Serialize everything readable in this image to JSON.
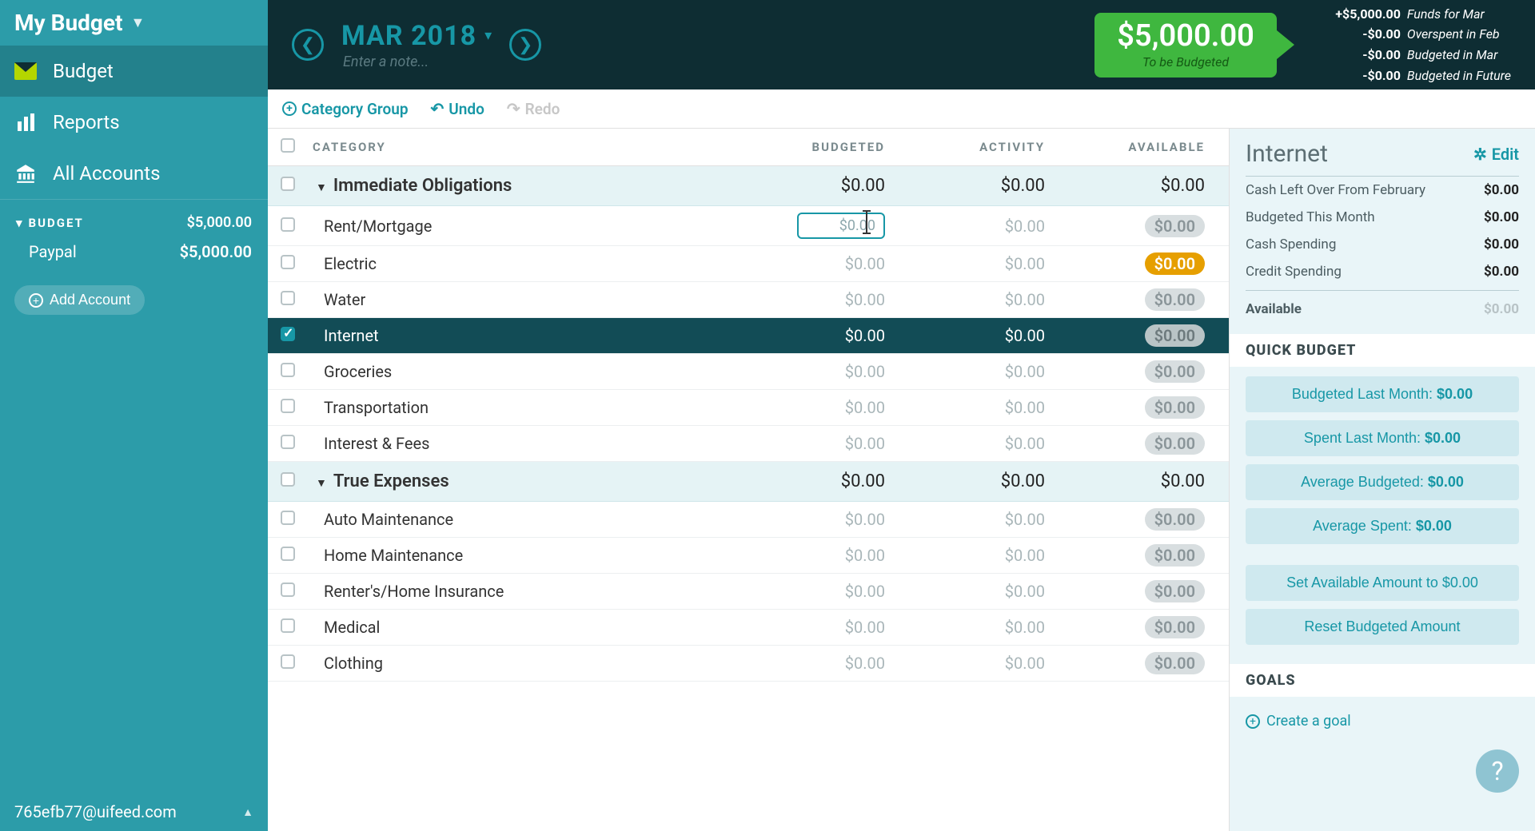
{
  "sidebar": {
    "title": "My Budget",
    "nav": [
      {
        "label": "Budget"
      },
      {
        "label": "Reports"
      },
      {
        "label": "All Accounts"
      }
    ],
    "budget_header": "BUDGET",
    "budget_total": "$5,000.00",
    "accounts": [
      {
        "name": "Paypal",
        "balance": "$5,000.00"
      }
    ],
    "add_account_label": "Add Account",
    "user_email": "765efb77@uifeed.com"
  },
  "header": {
    "month_label": "MAR 2018",
    "note_placeholder": "Enter a note...",
    "tbb_amount": "$5,000.00",
    "tbb_label": "To be Budgeted",
    "summary": [
      {
        "value": "+$5,000.00",
        "label": "Funds for Mar"
      },
      {
        "value": "-$0.00",
        "label": "Overspent in Feb"
      },
      {
        "value": "-$0.00",
        "label": "Budgeted in Mar"
      },
      {
        "value": "-$0.00",
        "label": "Budgeted in Future"
      }
    ]
  },
  "toolbar": {
    "category_group": "Category Group",
    "undo": "Undo",
    "redo": "Redo"
  },
  "grid": {
    "headers": {
      "category": "CATEGORY",
      "budgeted": "BUDGETED",
      "activity": "ACTIVITY",
      "available": "AVAILABLE"
    },
    "groups": [
      {
        "name": "Immediate Obligations",
        "budgeted": "$0.00",
        "activity": "$0.00",
        "available": "$0.00",
        "rows": [
          {
            "name": "Rent/Mortgage",
            "budgeted": "$0.00",
            "activity": "$0.00",
            "available": "$0.00",
            "editing": true
          },
          {
            "name": "Electric",
            "budgeted": "$0.00",
            "activity": "$0.00",
            "available": "$0.00",
            "warn": true
          },
          {
            "name": "Water",
            "budgeted": "$0.00",
            "activity": "$0.00",
            "available": "$0.00"
          },
          {
            "name": "Internet",
            "budgeted": "$0.00",
            "activity": "$0.00",
            "available": "$0.00",
            "selected": true,
            "checked": true
          },
          {
            "name": "Groceries",
            "budgeted": "$0.00",
            "activity": "$0.00",
            "available": "$0.00"
          },
          {
            "name": "Transportation",
            "budgeted": "$0.00",
            "activity": "$0.00",
            "available": "$0.00"
          },
          {
            "name": "Interest & Fees",
            "budgeted": "$0.00",
            "activity": "$0.00",
            "available": "$0.00"
          }
        ]
      },
      {
        "name": "True Expenses",
        "budgeted": "$0.00",
        "activity": "$0.00",
        "available": "$0.00",
        "rows": [
          {
            "name": "Auto Maintenance",
            "budgeted": "$0.00",
            "activity": "$0.00",
            "available": "$0.00"
          },
          {
            "name": "Home Maintenance",
            "budgeted": "$0.00",
            "activity": "$0.00",
            "available": "$0.00"
          },
          {
            "name": "Renter's/Home Insurance",
            "budgeted": "$0.00",
            "activity": "$0.00",
            "available": "$0.00"
          },
          {
            "name": "Medical",
            "budgeted": "$0.00",
            "activity": "$0.00",
            "available": "$0.00"
          },
          {
            "name": "Clothing",
            "budgeted": "$0.00",
            "activity": "$0.00",
            "available": "$0.00"
          }
        ]
      }
    ]
  },
  "inspector": {
    "title": "Internet",
    "edit_label": "Edit",
    "lines": [
      {
        "label": "Cash Left Over From February",
        "value": "$0.00"
      },
      {
        "label": "Budgeted This Month",
        "value": "$0.00"
      },
      {
        "label": "Cash Spending",
        "value": "$0.00"
      },
      {
        "label": "Credit Spending",
        "value": "$0.00"
      }
    ],
    "available_label": "Available",
    "available_value": "$0.00",
    "quick_budget_header": "QUICK BUDGET",
    "qb": [
      {
        "label": "Budgeted Last Month: ",
        "value": "$0.00"
      },
      {
        "label": "Spent Last Month: ",
        "value": "$0.00"
      },
      {
        "label": "Average Budgeted: ",
        "value": "$0.00"
      },
      {
        "label": "Average Spent: ",
        "value": "$0.00"
      }
    ],
    "set_available": "Set Available Amount to $0.00",
    "reset_budgeted": "Reset Budgeted Amount",
    "goals_header": "GOALS",
    "create_goal": "Create a goal"
  }
}
